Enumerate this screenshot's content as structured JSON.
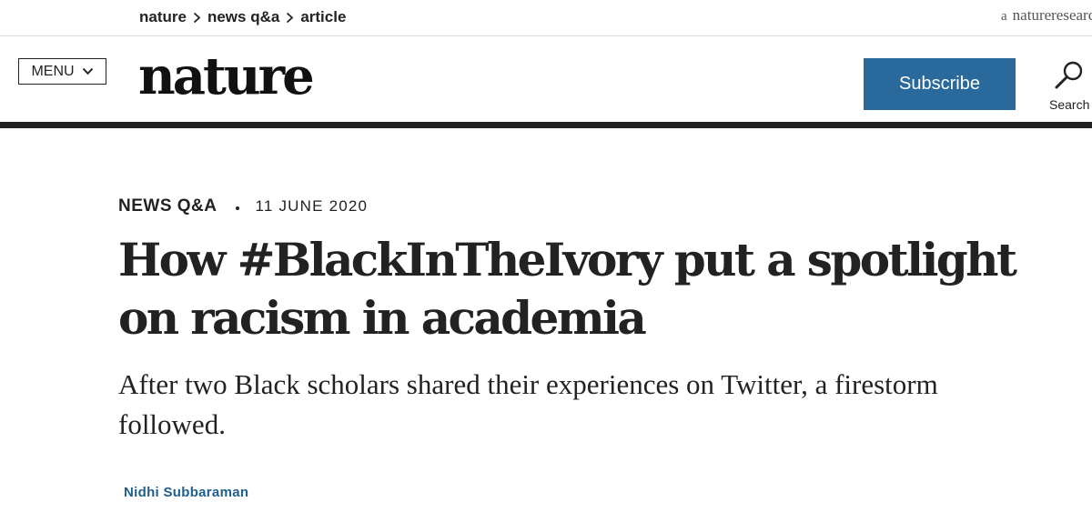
{
  "breadcrumb": {
    "items": [
      "nature",
      "news q&a",
      "article"
    ]
  },
  "brand_tag": {
    "prefix": "a",
    "name": "natureresearch"
  },
  "header": {
    "menu_label": "MENU",
    "logo_text": "nature",
    "subscribe_label": "Subscribe",
    "search_label": "Search"
  },
  "article": {
    "type": "NEWS Q&A",
    "date": "11 JUNE 2020",
    "title": "How #BlackInTheIvory put a spotlight on racism in academia",
    "standfirst": "After two Black scholars shared their experiences on Twitter, a firestorm followed.",
    "author": "Nidhi Subbaraman"
  },
  "colors": {
    "subscribe_bg": "#29699c",
    "author_link": "#1f5f8b",
    "header_rule": "#222222"
  },
  "icons": [
    "chevron-right-icon",
    "chevron-down-icon",
    "search-icon"
  ]
}
